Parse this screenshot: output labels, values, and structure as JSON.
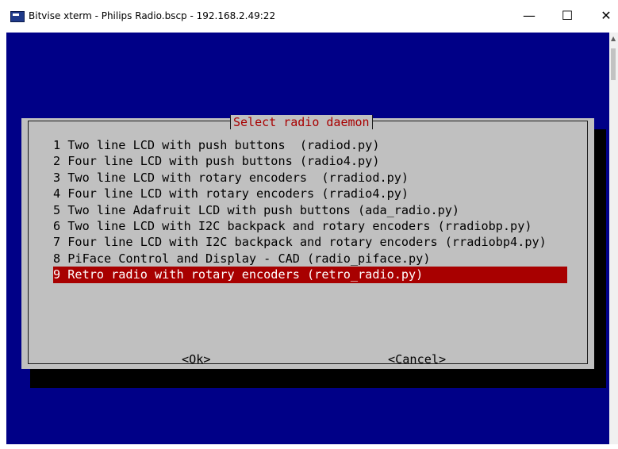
{
  "window": {
    "title": "Bitvise xterm - Philips Radio.bscp - 192.168.2.49:22",
    "minimize_glyph": "—",
    "maximize_glyph": "☐",
    "close_glyph": "✕"
  },
  "dialog": {
    "title": "Select radio daemon",
    "items": [
      {
        "label": "1 Two line LCD with push buttons  (radiod.py)"
      },
      {
        "label": "2 Four line LCD with push buttons (radio4.py)"
      },
      {
        "label": "3 Two line LCD with rotary encoders  (rradiod.py)"
      },
      {
        "label": "4 Four line LCD with rotary encoders (rradio4.py)"
      },
      {
        "label": "5 Two line Adafruit LCD with push buttons (ada_radio.py)"
      },
      {
        "label": "6 Two line LCD with I2C backpack and rotary encoders (rradiobp.py)"
      },
      {
        "label": "7 Four line LCD with I2C backpack and rotary encoders (rradiobp4.py)"
      },
      {
        "label": "8 PiFace Control and Display - CAD (radio_piface.py)"
      },
      {
        "label": "9 Retro radio with rotary encoders (retro_radio.py)",
        "selected": true
      }
    ],
    "ok_label": "<Ok>",
    "cancel_label": "<Cancel>"
  },
  "colors": {
    "terminal_bg": "#000087",
    "dialog_bg": "#c0c0c0",
    "title_text": "#a80000",
    "selection_bg": "#a80000",
    "selection_text": "#ffffff"
  }
}
